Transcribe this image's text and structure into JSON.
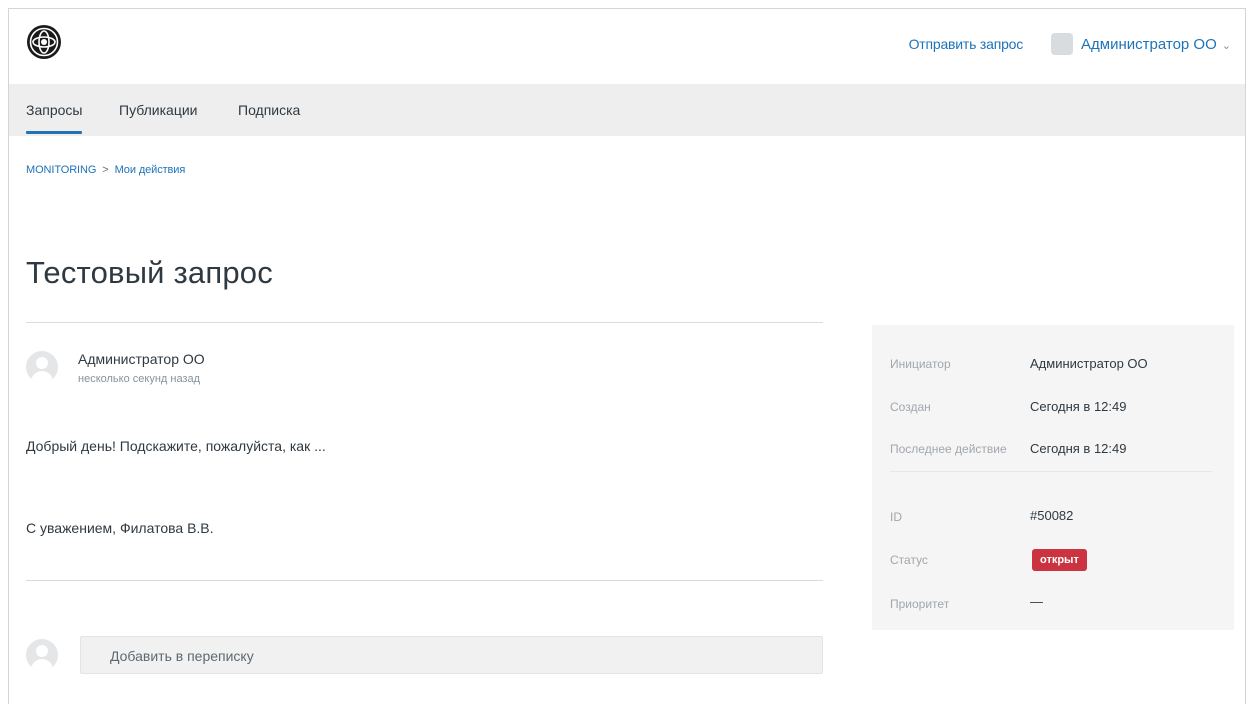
{
  "header": {
    "submit_request": "Отправить запрос",
    "user_name": "Администратор ОО",
    "user_caret": "⌄"
  },
  "nav": {
    "tabs": [
      {
        "label": "Запросы",
        "active": true
      },
      {
        "label": "Публикации",
        "active": false
      },
      {
        "label": "Подписка",
        "active": false
      }
    ]
  },
  "breadcrumb": {
    "items": [
      "MONITORING",
      "Мои действия"
    ],
    "separator": ">"
  },
  "request": {
    "title": "Тестовый запрос",
    "author": "Администратор ОО",
    "time": "несколько секунд назад",
    "body_lines": [
      "Добрый день! Подскажите, пожалуйста, как ...",
      "С уважением, Филатова В.В."
    ]
  },
  "reply": {
    "placeholder": "Добавить в переписку"
  },
  "details": {
    "initiator_label": "Инициатор",
    "initiator_value": "Администратор ОО",
    "created_label": "Создан",
    "created_value": "Сегодня в 12:49",
    "last_action_label": "Последнее действие",
    "last_action_value": "Сегодня в 12:49",
    "id_label": "ID",
    "id_value": "#50082",
    "status_label": "Статус",
    "status_value": "открыт",
    "priority_label": "Приоритет",
    "priority_value": "—"
  },
  "colors": {
    "accent": "#1f73b7",
    "status_open": "#cc3340",
    "nav_background": "#eeeeee"
  }
}
